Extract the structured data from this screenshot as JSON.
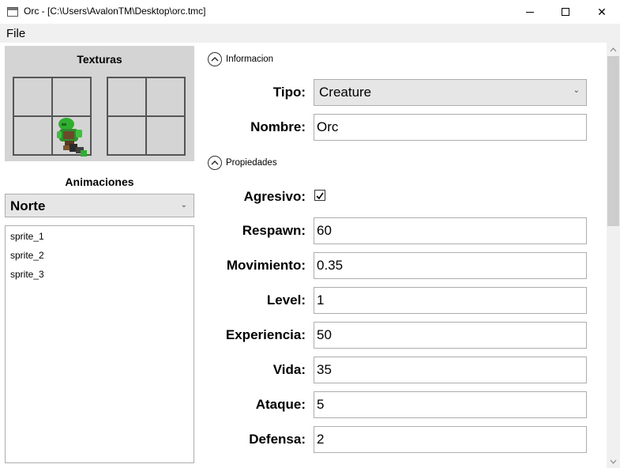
{
  "window": {
    "title": "Orc - [C:\\Users\\AvalonTM\\Desktop\\orc.tmc]",
    "close_glyph": "✕"
  },
  "menu": {
    "file": "File"
  },
  "textures": {
    "title": "Texturas"
  },
  "animations": {
    "title": "Animaciones",
    "selected": "Norte",
    "sprites": [
      "sprite_1",
      "sprite_2",
      "sprite_3"
    ]
  },
  "info": {
    "header": "Informacion",
    "tipo_label": "Tipo:",
    "tipo_value": "Creature",
    "nombre_label": "Nombre:",
    "nombre_value": "Orc"
  },
  "props": {
    "header": "Propiedades",
    "agresivo_label": "Agresivo:",
    "agresivo_checked": true,
    "respawn_label": "Respawn:",
    "respawn_value": "60",
    "movimiento_label": "Movimiento:",
    "movimiento_value": "0.35",
    "level_label": "Level:",
    "level_value": "1",
    "experiencia_label": "Experiencia:",
    "experiencia_value": "50",
    "vida_label": "Vida:",
    "vida_value": "35",
    "ataque_label": "Ataque:",
    "ataque_value": "5",
    "defensa_label": "Defensa:",
    "defensa_value": "2"
  },
  "colors": {
    "panel_gray": "#d4d4d4",
    "orc_green": "#2fae2f"
  }
}
